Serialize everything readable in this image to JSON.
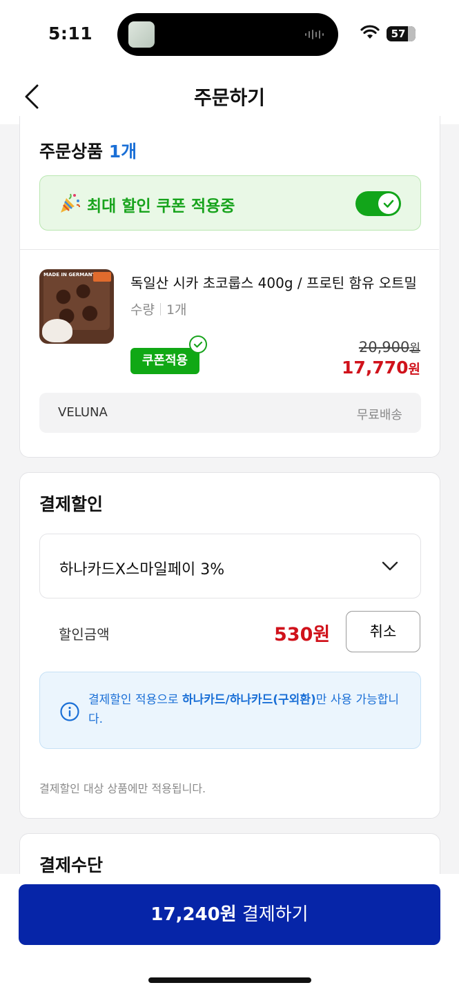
{
  "status_bar": {
    "time": "5:11",
    "battery": "57"
  },
  "nav": {
    "title": "주문하기"
  },
  "order": {
    "section_title": "주문상품",
    "count": "1개",
    "coupon_banner": "최대 할인 쿠폰 적용중",
    "coupon_toggle_on": true,
    "product": {
      "name": "독일산 시카 초코룹스 400g / 프로틴 함유 오트밀",
      "qty_label": "수량",
      "qty": "1개",
      "badge": "쿠폰적용",
      "original_price": "20,900",
      "sale_price": "17,770",
      "currency": "원"
    },
    "seller": "VELUNA",
    "shipping": "무료배송"
  },
  "payment_discount": {
    "title": "결제할인",
    "selected_option": "하나카드X스마일페이 3%",
    "discount_label": "할인금액",
    "discount_amount": "530원",
    "cancel_label": "취소",
    "info_prefix": "결제할인 적용으로 ",
    "info_bold": "하나카드/하나카드(구외환)",
    "info_suffix": "만 사용 가능합니다.",
    "footnote": "결제할인 대상 상품에만 적용됩니다."
  },
  "payment_method": {
    "title": "결제수단"
  },
  "checkout": {
    "amount": "17,240원",
    "label": "결제하기"
  },
  "colors": {
    "accent_blue": "#0625a8",
    "sale_red": "#d0121b",
    "coupon_green": "#10a815"
  },
  "icons": [
    "back-chevron-icon",
    "party-popper-icon",
    "check-icon",
    "chevron-down-icon",
    "info-icon",
    "wifi-icon"
  ]
}
